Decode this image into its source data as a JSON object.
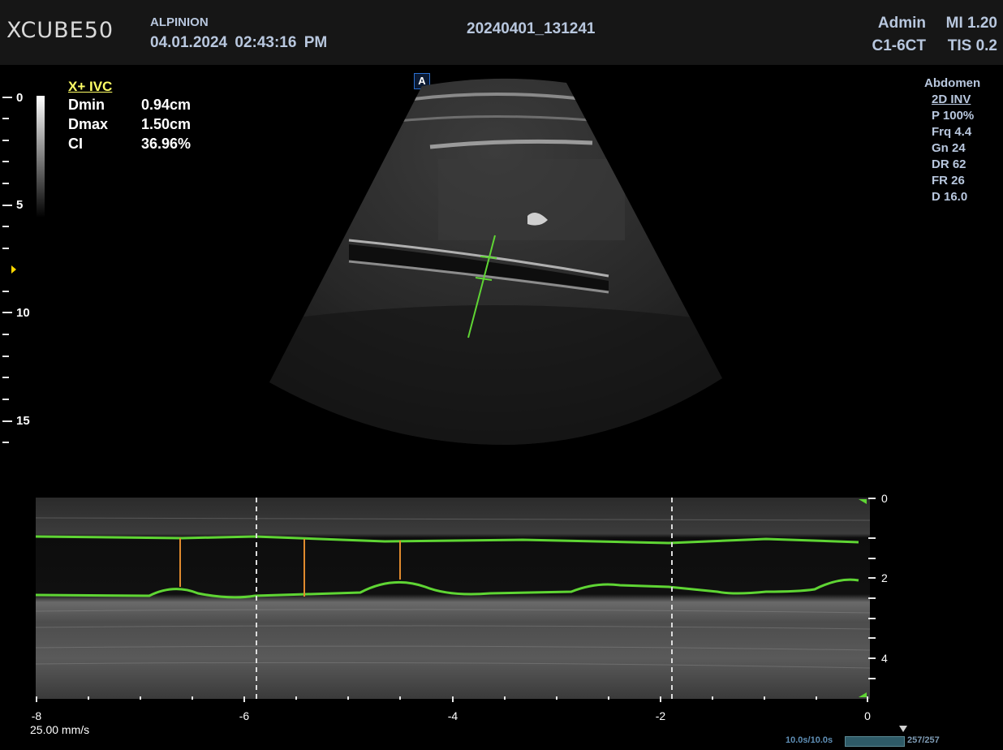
{
  "header": {
    "logo": "XCUBE50",
    "brand": "ALPINION",
    "date": "04.01.2024",
    "time": "02:43:16 PM",
    "study_id": "20240401_131241",
    "user": "Admin",
    "probe": "C1-6CT",
    "mi": "MI 1.20",
    "tis": "TIS 0.2"
  },
  "depth_scale": {
    "labels": [
      "0",
      "5",
      "10",
      "15"
    ],
    "unit_hint": "cm"
  },
  "measurement": {
    "title": "X+ IVC",
    "rows": [
      {
        "label": "Dmin",
        "value": "0.94cm"
      },
      {
        "label": "Dmax",
        "value": "1.50cm"
      },
      {
        "label": "CI",
        "value": "36.96%"
      }
    ]
  },
  "params": {
    "preset": "Abdomen",
    "items": [
      "2D INV",
      "P 100%",
      "Frq 4.4",
      "Gn 24",
      "DR 62",
      "FR 26",
      "D 16.0"
    ]
  },
  "probe_badge": "A",
  "mmode": {
    "depth_labels": [
      "0",
      "2",
      "4"
    ],
    "time_labels": [
      "-8",
      "-6",
      "-4",
      "-2",
      "0"
    ],
    "sweep_speed": "25.00 mm/s"
  },
  "cine": {
    "time": "10.0s/10.0s",
    "frames": "257/257",
    "progress": 1.0
  },
  "colors": {
    "trace": "#5fd534",
    "caliper": "#e08a2e",
    "text_info": "#b8c7de",
    "title_yellow": "#ffff66"
  }
}
